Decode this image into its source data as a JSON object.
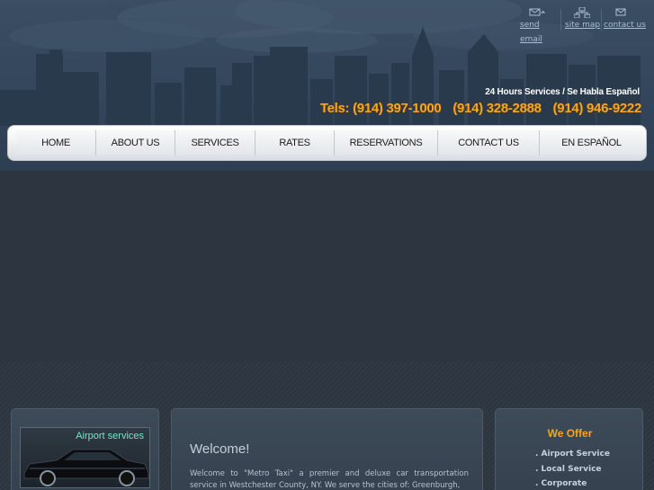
{
  "header": {
    "top_links": {
      "send_email": "send email",
      "site_map": "site map",
      "contact_us": "contact us"
    },
    "tagline": "24 Hours Services / Se Habla Español",
    "phones": [
      "Tels: (914) 397-1000",
      "(914) 328-2888",
      "(914) 946-9222"
    ]
  },
  "nav": {
    "items": [
      "HOME",
      "ABOUT US",
      "SERVICES",
      "RATES",
      "RESERVATIONS",
      "CONTACT US",
      "EN ESPAÑOL"
    ]
  },
  "airport_box": {
    "title": "Airport services"
  },
  "welcome": {
    "title": "Welcome!",
    "text": "Welcome to \"Metro Taxi\" a premier and deluxe car transportation service in Westchester County, NY. We serve the cities of: Greenburgh,"
  },
  "offer": {
    "title": "We Offer",
    "items": [
      ". Airport Service",
      ". Local Service",
      ". Corporate"
    ]
  },
  "colors": {
    "accent_orange": "#f5a623",
    "nav_bg": "#eef1f4",
    "page_bg": "#2e3641",
    "link": "#a9bfd6",
    "airport_title": "#7fe0c8"
  },
  "icons": [
    "email-icon",
    "sitemap-icon",
    "contact-icon"
  ]
}
